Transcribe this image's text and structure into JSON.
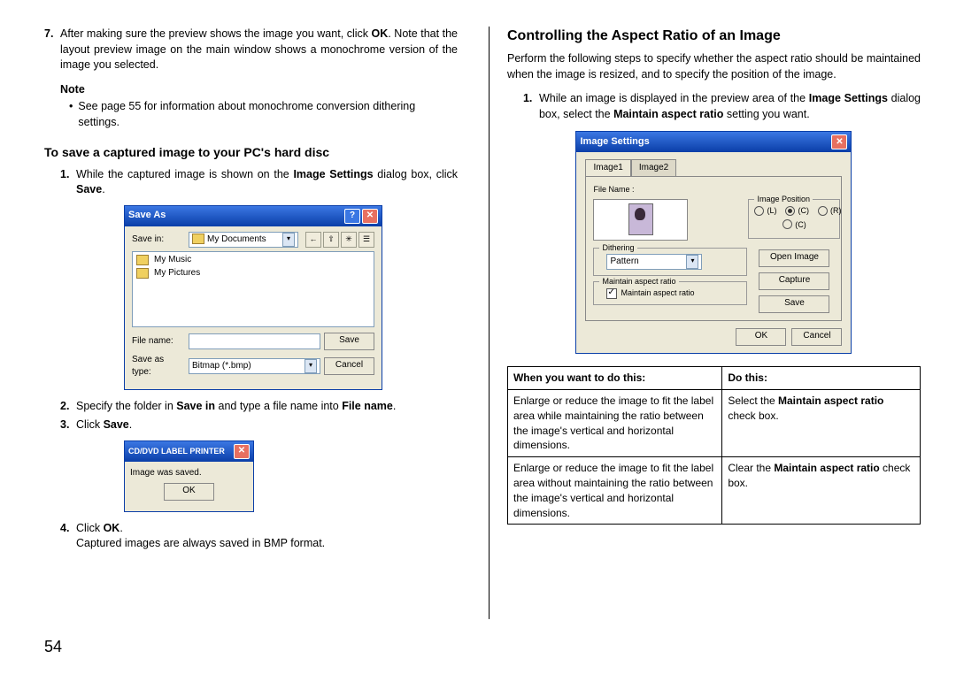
{
  "left": {
    "step7_num": "7.",
    "step7_a": "After making sure the preview shows the image you want, click ",
    "step7_ok": "OK",
    "step7_b": ". Note that the layout preview image on the main window shows a monochrome version of the image you selected.",
    "note_heading": "Note",
    "note_bullet": "See page 55 for information about monochrome conversion dithering settings.",
    "save_heading": "To save a captured image to your PC's hard disc",
    "step1_num": "1.",
    "step1_a": "While the captured image is shown on the ",
    "step1_b": "Image Settings",
    "step1_c": " dialog box, click ",
    "step1_d": "Save",
    "step1_e": ".",
    "step2_num": "2.",
    "step2_a": "Specify the folder in ",
    "step2_b": "Save in",
    "step2_c": " and type a file name into ",
    "step2_d": "File name",
    "step2_e": ".",
    "step3_num": "3.",
    "step3_a": "Click ",
    "step3_b": "Save",
    "step3_c": ".",
    "step4_num": "4.",
    "step4_a": "Click ",
    "step4_b": "OK",
    "step4_c": ".",
    "step4_note": "Captured images are always saved in BMP format."
  },
  "right": {
    "heading": "Controlling the Aspect Ratio of an Image",
    "intro": "Perform the following steps to specify whether the aspect ratio should be maintained when the image is resized, and to specify the position of the image.",
    "step1_num": "1.",
    "step1_a": "While an image is displayed in the preview area of the ",
    "step1_b": "Image Settings",
    "step1_c": " dialog box, select the ",
    "step1_d": "Maintain aspect ratio",
    "step1_e": " setting you want.",
    "table": {
      "h1": "When you want to do this:",
      "h2": "Do this:",
      "r1c1": "Enlarge or reduce the image to fit the label area while maintaining the ratio between the image's vertical and horizontal dimensions.",
      "r1c2_a": "Select the ",
      "r1c2_b": "Maintain aspect ratio",
      "r1c2_c": " check box.",
      "r2c1": "Enlarge or reduce the image to fit the label area without maintaining the ratio between the image's vertical and horizontal dimensions.",
      "r2c2_a": "Clear the ",
      "r2c2_b": "Maintain aspect ratio",
      "r2c2_c": " check box."
    }
  },
  "saveas": {
    "title": "Save As",
    "savein_label": "Save in:",
    "savein_value": "My Documents",
    "item1": "My Music",
    "item2": "My Pictures",
    "filename_label": "File name:",
    "saveastype_label": "Save as type:",
    "saveastype_value": "Bitmap (*.bmp)",
    "save_btn": "Save",
    "cancel_btn": "Cancel"
  },
  "confirm": {
    "title": "CD/DVD LABEL PRINTER",
    "msg": "Image was saved.",
    "ok": "OK"
  },
  "imgset": {
    "title": "Image Settings",
    "tab1": "Image1",
    "tab2": "Image2",
    "filename_label": "File Name :",
    "imgpos_label": "Image Position",
    "pos_l": "(L)",
    "pos_c": "(C)",
    "pos_r": "(R)",
    "dithering_label": "Dithering",
    "dithering_value": "Pattern",
    "maintain_group": "Maintain aspect ratio",
    "maintain_chk": "Maintain aspect ratio",
    "open_btn": "Open Image",
    "capture_btn": "Capture",
    "save_btn": "Save",
    "ok_btn": "OK",
    "cancel_btn": "Cancel"
  },
  "pagenum": "54"
}
